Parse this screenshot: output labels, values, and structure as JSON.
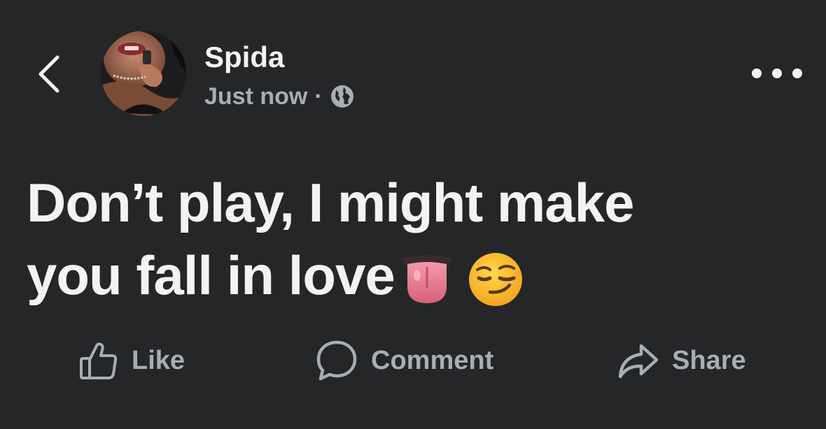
{
  "header": {
    "back_icon": "chevron-left-icon",
    "author_name": "Spida",
    "timestamp": "Just now",
    "separator": "·",
    "privacy_icon": "globe-icon",
    "more_icon": "more-horizontal-icon"
  },
  "post": {
    "text": "Don’t play, I might make you fall in love",
    "emojis": [
      "tongue-emoji",
      "smirking-face-emoji"
    ]
  },
  "actions": [
    {
      "label": "Like",
      "icon": "thumbs-up-icon"
    },
    {
      "label": "Comment",
      "icon": "comment-bubble-icon"
    },
    {
      "label": "Share",
      "icon": "share-arrow-icon"
    }
  ],
  "colors": {
    "background": "#242628",
    "primary_text": "#f2f3f5",
    "secondary_text": "#a9adb3"
  }
}
